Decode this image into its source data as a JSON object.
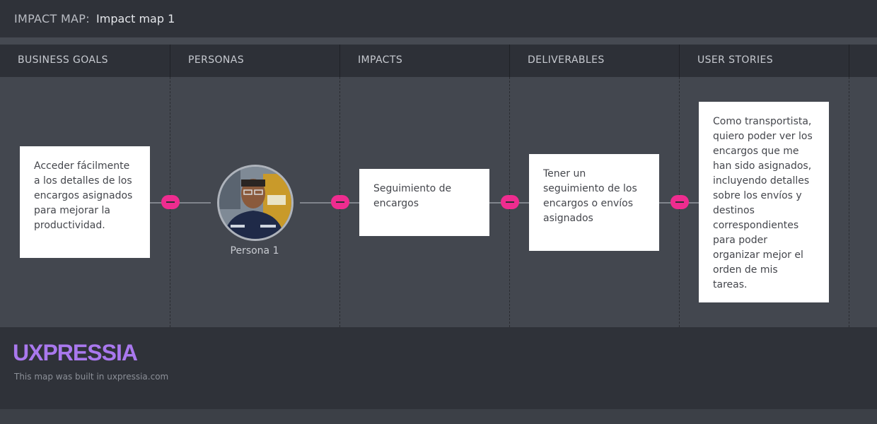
{
  "header": {
    "label": "IMPACT MAP:",
    "map_name": "Impact map 1"
  },
  "columns": [
    "BUSINESS GOALS",
    "PERSONAS",
    "IMPACTS",
    "DELIVERABLES",
    "USER STORIES"
  ],
  "goal": {
    "text": "Acceder fácilmente a los detalles de los encargos asignados para mejorar la productividad."
  },
  "persona": {
    "name": "Persona 1"
  },
  "impact": {
    "text": "Seguimiento de encargos"
  },
  "deliverable": {
    "text": "Tener un seguimiento de los encargos o envíos asignados"
  },
  "user_story": {
    "text": "Como transportista, quiero poder ver los encargos que me han sido asignados, incluyendo detalles sobre los envíos y destinos correspondientes para poder organizar mejor el orden de mis tareas."
  },
  "footer": {
    "brand": "UXPRESSIA",
    "note": "This map was built in uxpressia.com"
  },
  "colors": {
    "accent_toggle": "#ee2c8f",
    "brand": "#a978ee"
  }
}
